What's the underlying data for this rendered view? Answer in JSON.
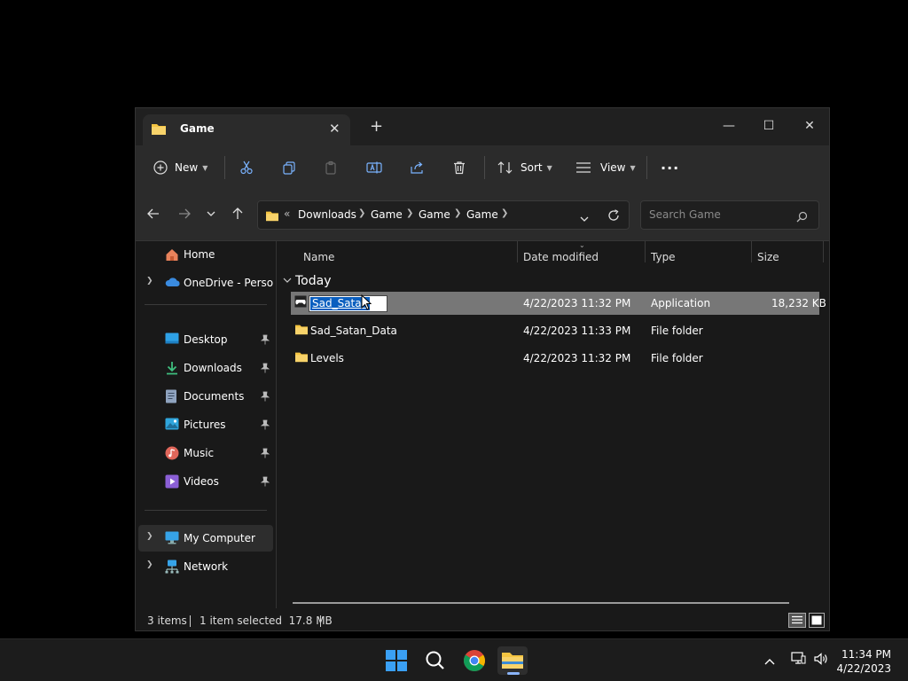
{
  "window": {
    "tab_title": "Game",
    "tab_close": "✕",
    "new_tab": "+",
    "minimize": "—",
    "maximize": "☐",
    "close": "✕"
  },
  "toolbar": {
    "new_label": "New",
    "sort_label": "Sort",
    "view_label": "View",
    "more": "···"
  },
  "address": {
    "overflow": "«",
    "crumbs": [
      "Downloads",
      "Game",
      "Game",
      "Game"
    ],
    "search_placeholder": "Search Game"
  },
  "sidebar": {
    "home": "Home",
    "onedrive": "OneDrive - Persona",
    "desktop": "Desktop",
    "downloads": "Downloads",
    "documents": "Documents",
    "pictures": "Pictures",
    "music": "Music",
    "videos": "Videos",
    "my_computer": "My Computer",
    "network": "Network"
  },
  "columns": {
    "name": "Name",
    "date": "Date modified",
    "type": "Type",
    "size": "Size"
  },
  "group_label": "Today",
  "files": [
    {
      "name": "Sad_Satan",
      "date": "4/22/2023 11:32 PM",
      "type": "Application",
      "size": "18,232 KB"
    },
    {
      "name": "Sad_Satan_Data",
      "date": "4/22/2023 11:33 PM",
      "type": "File folder",
      "size": ""
    },
    {
      "name": "Levels",
      "date": "4/22/2023 11:32 PM",
      "type": "File folder",
      "size": ""
    }
  ],
  "status": {
    "items": "3 items",
    "selected": "1 item selected  17.8 MB"
  },
  "taskbar": {
    "time": "11:34 PM",
    "date": "4/22/2023"
  },
  "colors": {
    "accent": "#0b5fbf",
    "folder": "#f5c542",
    "selected_row": "#777777"
  }
}
